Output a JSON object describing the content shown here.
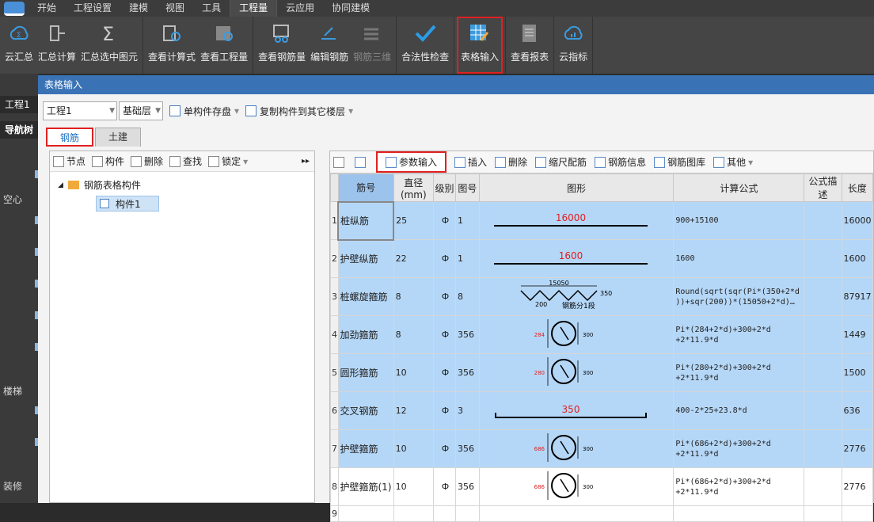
{
  "menu": {
    "tabs": [
      "开始",
      "工程设置",
      "建模",
      "视图",
      "工具",
      "工程量",
      "云应用",
      "协同建模"
    ],
    "active": "工程量"
  },
  "ribbon": {
    "groups": [
      [
        {
          "label": "云汇总",
          "icon": "cloud-sum-icon"
        },
        {
          "label": "汇总计算",
          "icon": "sum-calc-icon"
        },
        {
          "label": "汇总选中图元",
          "icon": "sigma-icon"
        }
      ],
      [
        {
          "label": "查看计算式",
          "icon": "formula-view-icon"
        },
        {
          "label": "查看工程量",
          "icon": "quantity-view-icon"
        }
      ],
      [
        {
          "label": "查看钢筋量",
          "icon": "rebar-view-icon"
        },
        {
          "label": "编辑钢筋",
          "icon": "rebar-edit-icon"
        },
        {
          "label": "钢筋三维",
          "icon": "rebar-3d-icon",
          "disabled": true
        }
      ],
      [
        {
          "label": "合法性检查",
          "icon": "check-icon"
        }
      ],
      [
        {
          "label": "表格输入",
          "icon": "table-input-icon",
          "highlight": true
        }
      ],
      [
        {
          "label": "查看报表",
          "icon": "report-icon"
        }
      ],
      [
        {
          "label": "云指标",
          "icon": "cloud-index-icon"
        }
      ]
    ]
  },
  "sidebar": {
    "project": "工程1",
    "nav": "导航树",
    "items": [
      "空心",
      "楼梯",
      "装修"
    ]
  },
  "dialog": {
    "title": "表格输入",
    "project_select": "工程1",
    "floor_select": "基础层",
    "save_label": "单构件存盘",
    "copy_label": "复制构件到其它楼层",
    "tabs": [
      "钢筋",
      "土建"
    ],
    "left_toolbar": [
      "节点",
      "构件",
      "删除",
      "查找",
      "锁定"
    ],
    "tree_root": "钢筋表格构件",
    "tree_child": "构件1",
    "right_toolbar": [
      "参数输入",
      "插入",
      "删除",
      "缩尺配筋",
      "钢筋信息",
      "钢筋图库",
      "其他"
    ],
    "columns": [
      "筋号",
      "直径(mm)",
      "级别",
      "图号",
      "图形",
      "计算公式",
      "公式描述",
      "长度"
    ],
    "rows": [
      {
        "no": "1",
        "name": "桩纵筋",
        "dia": "25",
        "grade": "Ф",
        "fig": "1",
        "shape": "line",
        "shape_label": "16000",
        "formula": "900+15100",
        "len": "16000"
      },
      {
        "no": "2",
        "name": "护壁纵筋",
        "dia": "22",
        "grade": "Ф",
        "fig": "1",
        "shape": "line",
        "shape_label": "1600",
        "formula": "1600",
        "len": "1600"
      },
      {
        "no": "3",
        "name": "桩螺旋箍筋",
        "dia": "8",
        "grade": "Ф",
        "fig": "8",
        "shape": "spiral",
        "shape_label": "15050",
        "shape_label2": "350",
        "shape_label3": "200",
        "shape_label4": "钢筋分1段",
        "formula": "Round(sqrt(sqr(Pi*(350+2*d\n))+sqr(200))*(15050+2*d)…",
        "len": "87917"
      },
      {
        "no": "4",
        "name": "加劲箍筋",
        "dia": "8",
        "grade": "Ф",
        "fig": "356",
        "shape": "circle",
        "shape_label": "284",
        "shape_label2": "300",
        "formula": "Pi*(284+2*d)+300+2*d\n+2*11.9*d",
        "len": "1449"
      },
      {
        "no": "5",
        "name": "圆形箍筋",
        "dia": "10",
        "grade": "Ф",
        "fig": "356",
        "shape": "circle",
        "shape_label": "280",
        "shape_label2": "300",
        "formula": "Pi*(280+2*d)+300+2*d\n+2*11.9*d",
        "len": "1500"
      },
      {
        "no": "6",
        "name": "交叉钢筋",
        "dia": "12",
        "grade": "Ф",
        "fig": "3",
        "shape": "hook",
        "shape_label": "350",
        "formula": "400-2*25+23.8*d",
        "len": "636"
      },
      {
        "no": "7",
        "name": "护壁箍筋",
        "dia": "10",
        "grade": "Ф",
        "fig": "356",
        "shape": "circle",
        "shape_label": "686",
        "shape_label2": "300",
        "formula": "Pi*(686+2*d)+300+2*d\n+2*11.9*d",
        "len": "2776"
      },
      {
        "no": "8",
        "name": "护壁箍筋(1)",
        "dia": "10",
        "grade": "Ф",
        "fig": "356",
        "shape": "circle",
        "shape_label": "686",
        "shape_label2": "300",
        "formula": "Pi*(686+2*d)+300+2*d\n+2*11.9*d",
        "len": "2776"
      },
      {
        "no": "9",
        "name": "",
        "dia": "",
        "grade": "",
        "fig": "",
        "shape": "none",
        "formula": "",
        "len": ""
      }
    ]
  }
}
